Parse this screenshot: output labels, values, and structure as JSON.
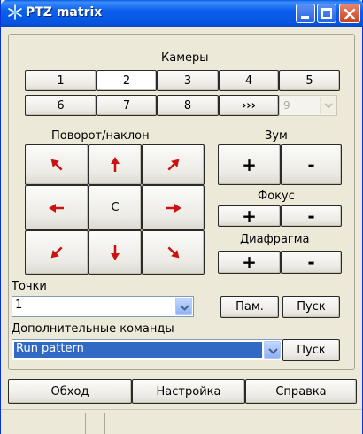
{
  "window": {
    "title": "PTZ matrix"
  },
  "cameras": {
    "label": "Камеры",
    "buttons": [
      "1",
      "2",
      "3",
      "4",
      "5",
      "6",
      "7",
      "8",
      "›››"
    ],
    "selected": "2",
    "extra_select": {
      "value": "9"
    }
  },
  "pan_tilt": {
    "label": "Поворот/наклон",
    "center_label": "C"
  },
  "zoom": {
    "label": "Зум",
    "plus": "+",
    "minus": "-"
  },
  "focus": {
    "label": "Фокус",
    "plus": "+",
    "minus": "-"
  },
  "iris": {
    "label": "Диафрагма",
    "plus": "+",
    "minus": "-"
  },
  "presets": {
    "label": "Точки",
    "select_value": "1",
    "save_label": "Пам.",
    "go_label": "Пуск"
  },
  "extra_commands": {
    "label": "Дополнительные команды",
    "select_value": "Run pattern",
    "go_label": "Пуск"
  },
  "bottom": {
    "tour_label": "Обход",
    "settings_label": "Настройка",
    "help_label": "Справка"
  },
  "colors": {
    "arrow": "#cc1111",
    "title_bar": "#0b60ed",
    "window_bg": "#ece9d8",
    "selection": "#316ac5"
  }
}
